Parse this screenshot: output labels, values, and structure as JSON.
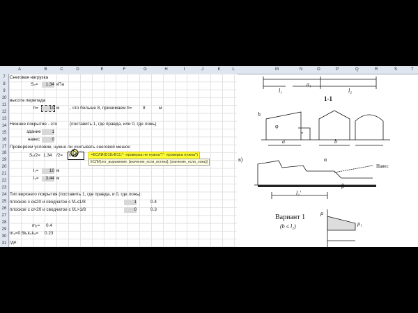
{
  "columns": [
    "A",
    "B",
    "C",
    "D",
    "E",
    "F",
    "G",
    "H",
    "I",
    "J",
    "K",
    "L",
    "M",
    "N",
    "O",
    "P",
    "Q",
    "R",
    "S",
    "T"
  ],
  "rows": [
    "7",
    "8",
    "9",
    "10",
    "11",
    "12",
    "13",
    "14",
    "15",
    "16",
    "17",
    "18",
    "19",
    "20",
    "21",
    "22",
    "23",
    "24",
    "25",
    "26",
    "27",
    "28",
    "29",
    "30",
    "31"
  ],
  "cells": {
    "r7_title": "Снеговая нагрузка",
    "r8_label": "S₀=",
    "r8_value": "1.34",
    "r8_unit": "кПа",
    "r10_label": "высота перепада",
    "r11_label": "h=",
    "r11_value": "10",
    "r11_unit": "м",
    "r11_note": ", что больше 8, принимаем h=",
    "r11_note_value": "8",
    "r11_note_unit": "м",
    "r13_label": "Нижнее покрытие - это",
    "r13_note": "(поставить 1, где правда, или 0, где ложь)",
    "r14_label": "здание",
    "r14_value": "1",
    "r15_label": "навес",
    "r15_value": "0",
    "r17_label": "Проверяем условие, нужно ли учитывать снеговой мешок:",
    "r18_label": "S₀/2=",
    "r18_value": "1.34",
    "r18_op": "/2=",
    "r18_cell": "0.67",
    "formula": "=ЕСЛИ(D18>B11;\"- проверка не нужна\";\"- проверка нужна\")",
    "tooltip": "ЕСЛИ(лог_выражение; [значение_если_истина]; [значение_если_ложь])",
    "r20_label": "l₁=",
    "r20_value": "10",
    "r20_unit": "м",
    "r21_label": "l₂=",
    "r21_value": "3.44",
    "r21_unit": "м",
    "r23_label": "Тип верхнего покрытия (поставить 1, где правда, и 0, где ложь):",
    "r24_label": "плоское с α≤20 и сводчатое с f/L≤1/8",
    "r24_value": "1",
    "r24_extra": "0.4",
    "r25_label": "плоское с α>20 и сводчатое с f/L>1/8",
    "r25_value": "0",
    "r25_extra": "0.3",
    "r27_label": "m₁=",
    "r27_value": "0.4",
    "r29_label": "m₂=0.5k₁k₂k₃=",
    "r29_value": "0.23",
    "r31_label": "где:"
  },
  "drawing": {
    "section_label": "1-1",
    "dim_a1": "a₁",
    "dim_l1": "l₁",
    "dim_l2": "l₂",
    "label_h": "h",
    "label_phi": "φ",
    "label_a": "a",
    "label_b": "b",
    "label_v": "в)",
    "label_alpha": "α",
    "label_naves": "Навес",
    "label_lprime": "l₁'",
    "label_beta": "β",
    "variant": "Вариант 1",
    "variant_cond": "(b ≤ l₂)",
    "label_mu": "μ",
    "label_mu1": "μ₁"
  }
}
